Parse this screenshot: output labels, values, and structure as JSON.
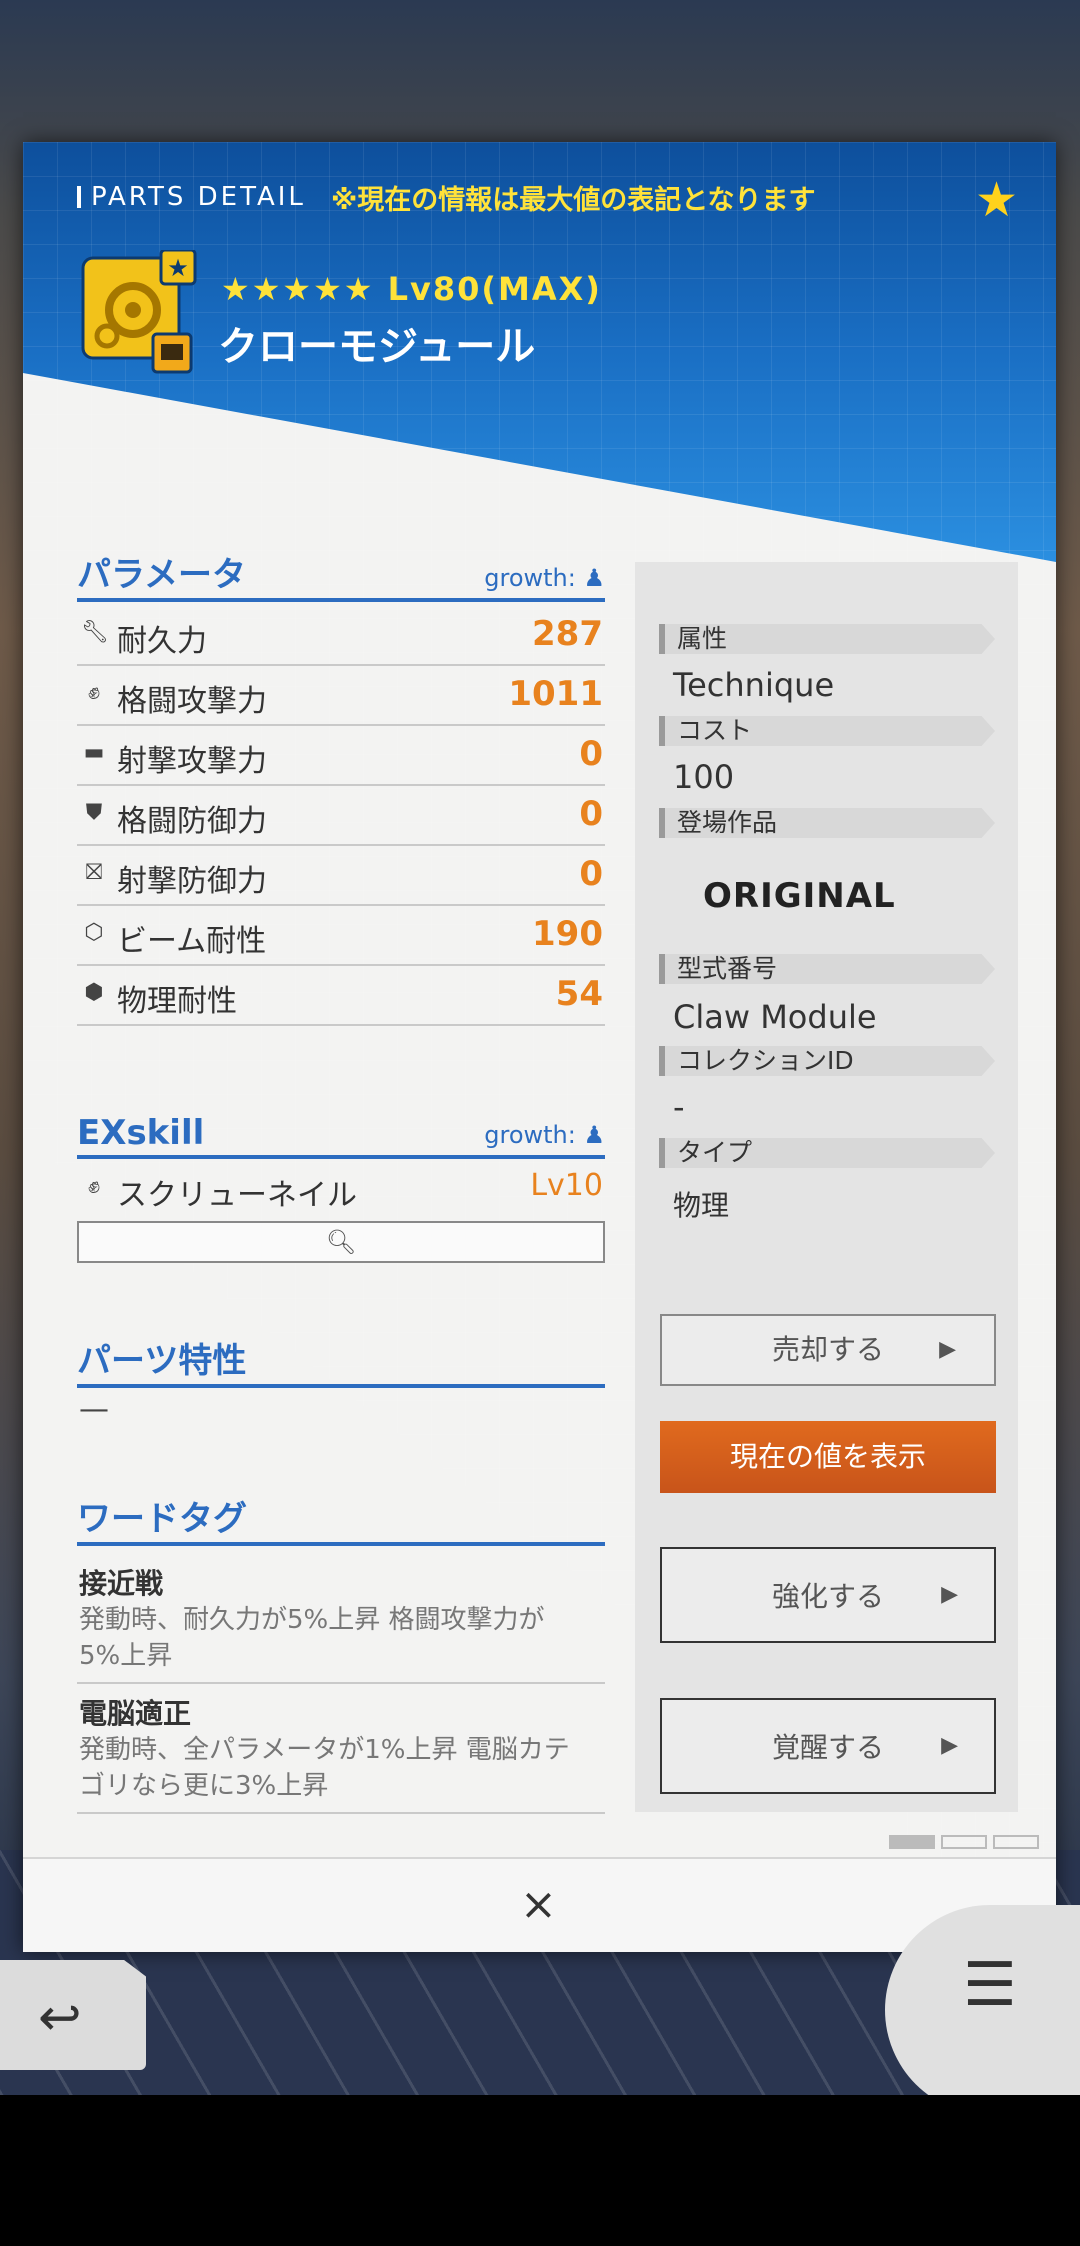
{
  "header": {
    "section_label": "PARTS DETAIL",
    "notice": "※現在の情報は最大値の表記となります",
    "favorite_icon": "star-icon",
    "rarity": "★★★★★  Lv80(MAX)",
    "part_name": "クローモジュール"
  },
  "parameters": {
    "title": "パラメータ",
    "growth_label": "growth:",
    "rows": [
      {
        "label": "耐久力",
        "value": "287",
        "icon": "wrench-icon"
      },
      {
        "label": "格闘攻撃力",
        "value": "1011",
        "icon": "fist-icon"
      },
      {
        "label": "射撃攻撃力",
        "value": "0",
        "icon": "gun-icon"
      },
      {
        "label": "格闘防御力",
        "value": "0",
        "icon": "melee-shield-icon"
      },
      {
        "label": "射撃防御力",
        "value": "0",
        "icon": "shot-shield-icon"
      },
      {
        "label": "ビーム耐性",
        "value": "190",
        "icon": "beam-resist-icon"
      },
      {
        "label": "物理耐性",
        "value": "54",
        "icon": "physical-resist-icon"
      }
    ]
  },
  "exskill": {
    "title": "EXskill",
    "growth_label": "growth:",
    "skill_name": "スクリューネイル",
    "skill_level": "Lv10"
  },
  "traits": {
    "title": "パーツ特性",
    "value": "—"
  },
  "word_tags": {
    "title": "ワードタグ",
    "items": [
      {
        "name": "接近戦",
        "desc": "発動時、耐久力が5%上昇 格闘攻撃力が5%上昇"
      },
      {
        "name": "電脳適正",
        "desc": "発動時、全パラメータが1%上昇 電脳カテゴリなら更に3%上昇"
      }
    ]
  },
  "info": {
    "attribute_label": "属性",
    "attribute_value": "Technique",
    "cost_label": "コスト",
    "cost_value": "100",
    "series_label": "登場作品",
    "series_value": "ORIGINAL",
    "model_label": "型式番号",
    "model_value": "Claw Module",
    "collection_label": "コレクションID",
    "collection_value": "-",
    "type_label": "タイプ",
    "type_value": "物理"
  },
  "actions": {
    "sell": "売却する",
    "show_current": "現在の値を表示",
    "enhance": "強化する",
    "awaken": "覚醒する"
  },
  "footer": {
    "close": "×",
    "back_icon": "back-arrow-icon",
    "menu_icon": "hamburger-menu-icon"
  },
  "colors": {
    "accent_blue": "#2c6cc0",
    "value_orange": "#e8821e",
    "highlight_yellow": "#ffe23a",
    "button_orange": "#d45f1c"
  }
}
